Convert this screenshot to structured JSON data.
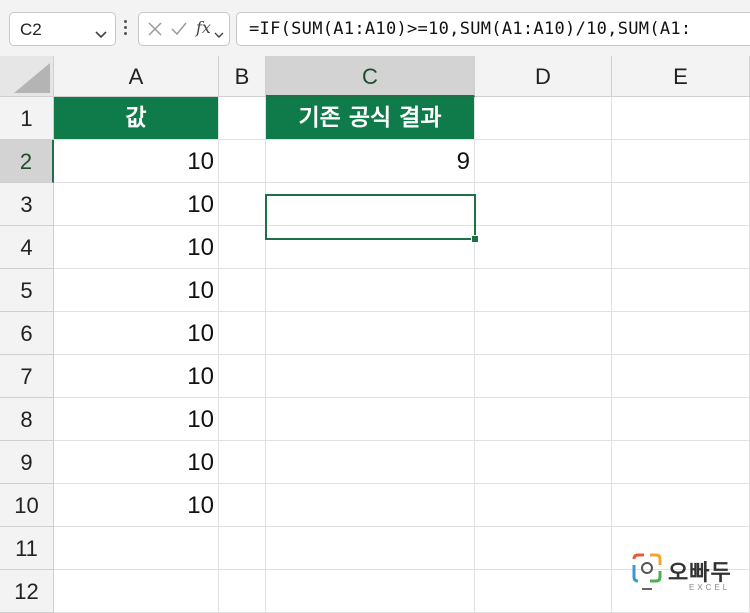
{
  "formula_bar": {
    "name_box": "C2",
    "fx_label": "fx",
    "formula": "=IF(SUM(A1:A10)>=10,SUM(A1:A10)/10,SUM(A1:"
  },
  "columns": [
    "A",
    "B",
    "C",
    "D",
    "E"
  ],
  "selected_column": "C",
  "rows": [
    "1",
    "2",
    "3",
    "4",
    "5",
    "6",
    "7",
    "8",
    "9",
    "10",
    "11",
    "12"
  ],
  "selected_row": "2",
  "cells": {
    "A1": "값",
    "A2": "10",
    "A3": "10",
    "A4": "10",
    "A5": "10",
    "A6": "10",
    "A7": "10",
    "A8": "10",
    "A9": "10",
    "A10": "10",
    "C1": "기존 공식 결과",
    "C2": "9"
  },
  "colors": {
    "header_fill": "#0f7a4a",
    "selection": "#1e7145"
  },
  "watermark": {
    "brand": "오빠두",
    "sub": "EXCEL"
  }
}
